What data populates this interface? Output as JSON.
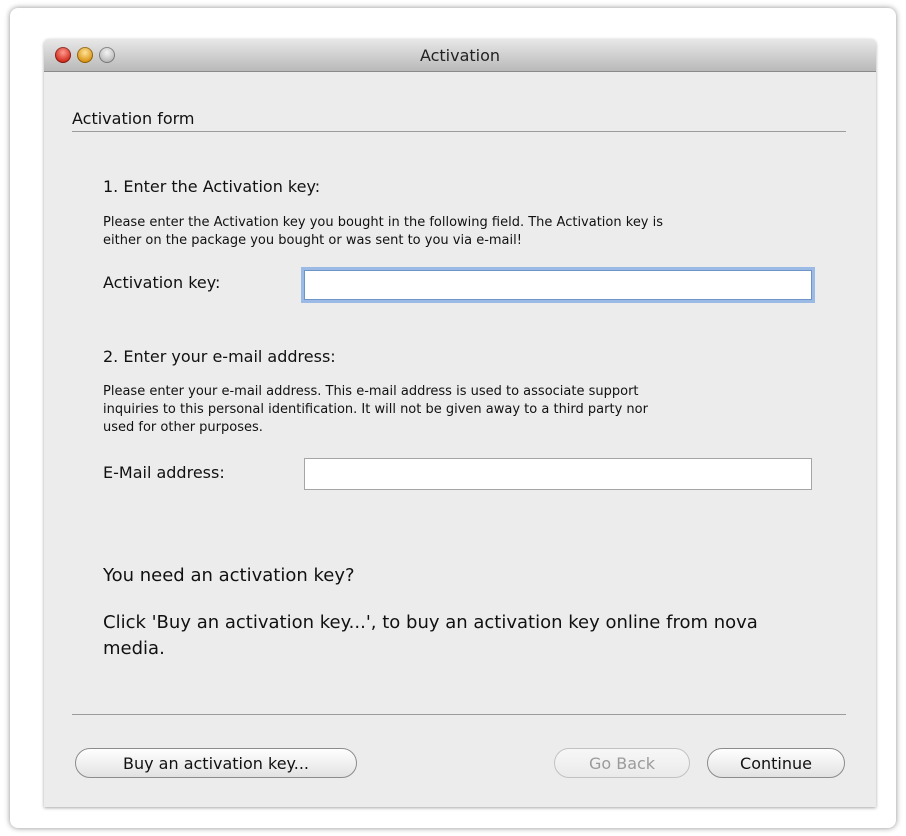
{
  "window": {
    "title": "Activation"
  },
  "form": {
    "section_title": "Activation form",
    "step1": {
      "heading": "1. Enter the Activation key:",
      "description_line1": "Please enter the Activation key you bought in the following field. The Activation key is",
      "description_line2": "either on the package you bought or was sent to you via e-mail!",
      "label": "Activation key:",
      "value": ""
    },
    "step2": {
      "heading": "2. Enter your e-mail address:",
      "description_line1": "Please enter your e-mail address. This e-mail address is used to  associate support",
      "description_line2": "inquiries to this personal identification. It will not be given away to a third party nor",
      "description_line3": "used for other purposes.",
      "label": "E-Mail address:",
      "value": ""
    },
    "info": {
      "question": "You need an activation key?",
      "hint_line1": "Click 'Buy an activation key...', to buy an activation key online from nova",
      "hint_line2": "media."
    }
  },
  "buttons": {
    "buy": "Buy an activation key...",
    "back": "Go Back",
    "continue": "Continue"
  }
}
